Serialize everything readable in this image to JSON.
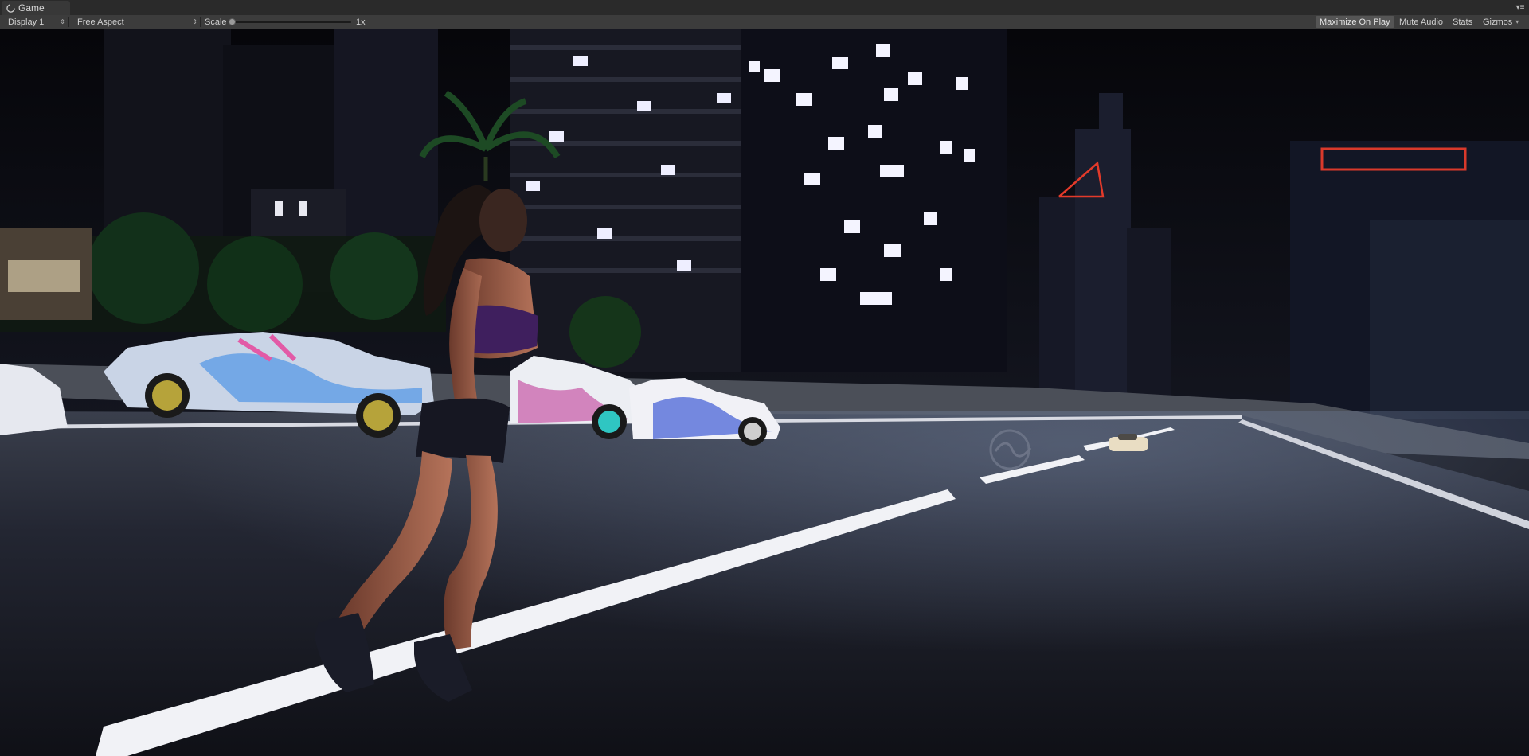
{
  "tab": {
    "title": "Game",
    "icon": "game-controller-icon",
    "menu_icon": "panel-menu-icon"
  },
  "toolbar": {
    "display_label": "Display 1",
    "aspect_label": "Free Aspect",
    "scale_label": "Scale",
    "scale_value": "1x",
    "scale_fraction": 0,
    "maximize_label": "Maximize On Play",
    "maximize_active": true,
    "mute_label": "Mute Audio",
    "stats_label": "Stats",
    "gizmos_label": "Gizmos"
  },
  "colors": {
    "tab_bg": "#383838",
    "toolbar_bg": "#3c3c3c",
    "active_button": "#555555"
  }
}
